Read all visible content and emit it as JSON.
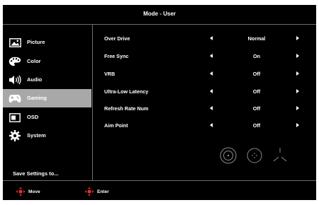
{
  "header": {
    "title": "Mode - User"
  },
  "sidebar": {
    "items": [
      {
        "label": "Picture",
        "icon": "picture-icon",
        "active": false
      },
      {
        "label": "Color",
        "icon": "palette-icon",
        "active": false
      },
      {
        "label": "Audio",
        "icon": "speaker-icon",
        "active": false
      },
      {
        "label": "Gaming",
        "icon": "gamepad-icon",
        "active": true
      },
      {
        "label": "OSD",
        "icon": "osd-icon",
        "active": false
      },
      {
        "label": "System",
        "icon": "gear-icon",
        "active": false
      }
    ],
    "save_label": "Save Settings to..."
  },
  "settings": [
    {
      "name": "Over Drive",
      "value": "Normal"
    },
    {
      "name": "Free Sync",
      "value": "On"
    },
    {
      "name": "VRB",
      "value": "Off"
    },
    {
      "name": "Ultra-Low Latency",
      "value": "Off"
    },
    {
      "name": "Refresh Rate Num",
      "value": "Off"
    },
    {
      "name": "Aim Point",
      "value": "Off"
    }
  ],
  "aim_point_icons": [
    "crosshair-circle-dot-icon",
    "crosshair-circle-icon",
    "crosshair-tri-icon"
  ],
  "footer": {
    "move_label": "Move",
    "enter_label": "Enter"
  },
  "colors": {
    "background": "#000000",
    "active_item": "#a8a8a8",
    "accent_red": "#e0332d",
    "text": "#ffffff"
  }
}
